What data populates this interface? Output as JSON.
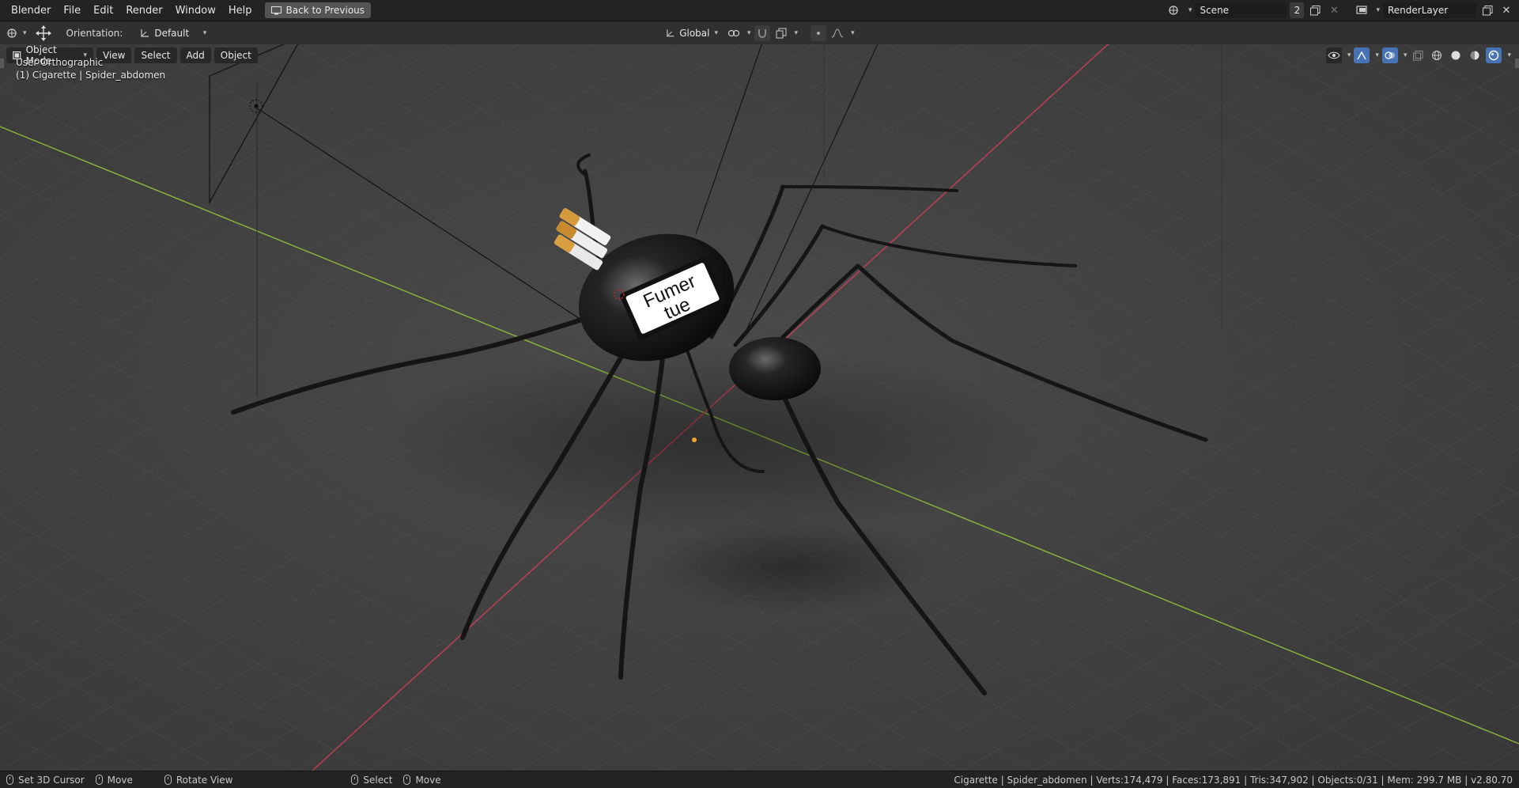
{
  "topbar": {
    "menus": [
      "Blender",
      "File",
      "Edit",
      "Render",
      "Window",
      "Help"
    ],
    "back_button": "Back to Previous",
    "scene_name": "Scene",
    "scene_count": "2",
    "render_layer": "RenderLayer"
  },
  "toolheader": {
    "orientation_label": "Orientation:",
    "orientation_value": "Default",
    "transform_orientation": "Global"
  },
  "viewport_header": {
    "mode": "Object Mode",
    "menus": [
      "View",
      "Select",
      "Add",
      "Object"
    ]
  },
  "viewport": {
    "view_name": "User Orthographic",
    "active_object": "(1) Cigarette | Spider_abdomen",
    "label_text_line1": "Fumer",
    "label_text_line2": "tue"
  },
  "statusbar": {
    "set_cursor": "Set 3D Cursor",
    "move1": "Move",
    "rotate_view": "Rotate View",
    "select": "Select",
    "move2": "Move",
    "stats": "Cigarette | Spider_abdomen | Verts:174,479 | Faces:173,891 | Tris:347,902 | Objects:0/31 | Mem: 299.7 MB | v2.80.70"
  },
  "colors": {
    "x_axis": "#c6404f",
    "y_axis": "#8cb83b",
    "accent": "#4772b3"
  }
}
